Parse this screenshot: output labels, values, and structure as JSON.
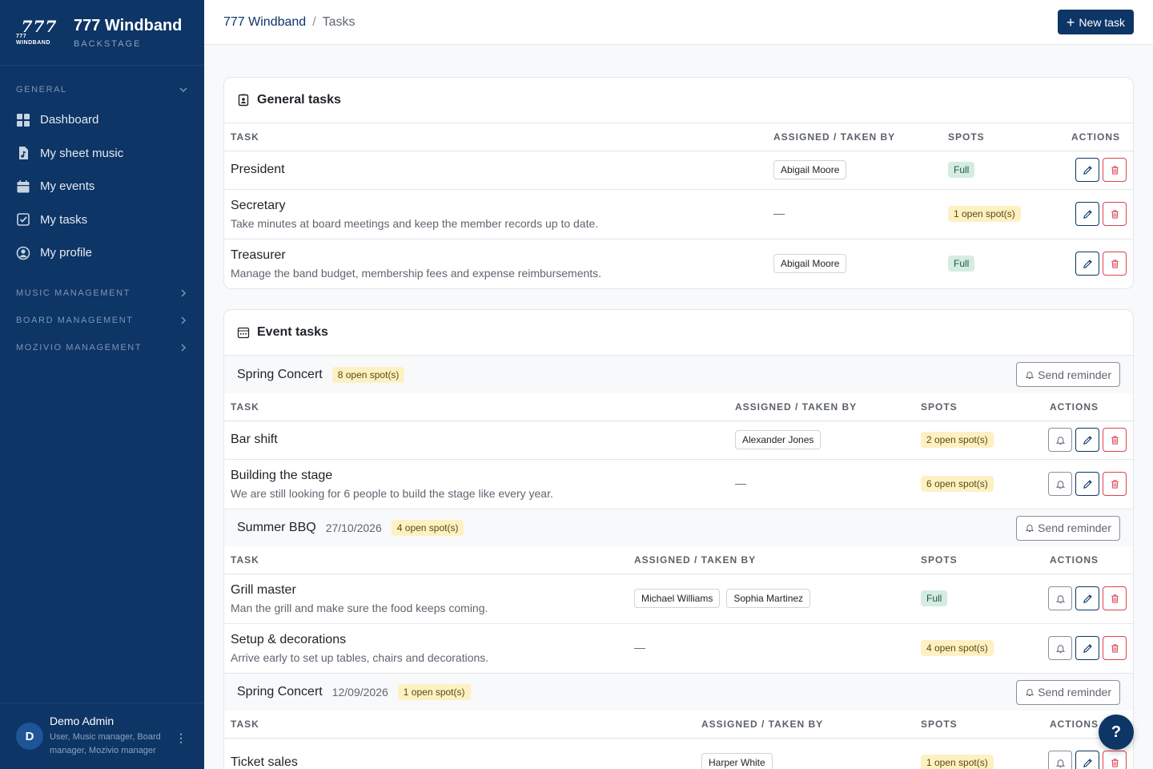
{
  "brand": {
    "logo_text": "777",
    "logo_sub": "777 WINDBAND",
    "name": "777 Windband",
    "sub": "BACKSTAGE"
  },
  "sidebar": {
    "general_label": "GENERAL",
    "items": [
      {
        "label": "Dashboard",
        "icon": "dashboard-icon"
      },
      {
        "label": "My sheet music",
        "icon": "sheet-music-icon"
      },
      {
        "label": "My events",
        "icon": "calendar-icon"
      },
      {
        "label": "My tasks",
        "icon": "checkbox-icon"
      },
      {
        "label": "My profile",
        "icon": "user-circle-icon"
      }
    ],
    "sections": [
      {
        "label": "MUSIC MANAGEMENT"
      },
      {
        "label": "BOARD MANAGEMENT"
      },
      {
        "label": "MOZIVIO MANAGEMENT"
      }
    ],
    "user": {
      "initial": "D",
      "name": "Demo Admin",
      "roles": "User, Music manager, Board manager, Mozivio manager"
    }
  },
  "breadcrumb": {
    "root": "777 Windband",
    "sep": "/",
    "current": "Tasks"
  },
  "new_task_label": "New task",
  "general": {
    "title": "General tasks",
    "columns": {
      "task": "TASK",
      "assigned": "ASSIGNED / TAKEN BY",
      "spots": "SPOTS",
      "actions": "ACTIONS"
    },
    "rows": [
      {
        "title": "President",
        "desc": "",
        "assigned": [
          "Abigail Moore"
        ],
        "spots": "Full",
        "full": true
      },
      {
        "title": "Secretary",
        "desc": "Take minutes at board meetings and keep the member records up to date.",
        "assigned": [],
        "spots": "1 open spot(s)",
        "full": false
      },
      {
        "title": "Treasurer",
        "desc": "Manage the band budget, membership fees and expense reimbursements.",
        "assigned": [
          "Abigail Moore"
        ],
        "spots": "Full",
        "full": true
      }
    ]
  },
  "events": {
    "title": "Event tasks",
    "reminder_label": "Send reminder",
    "dash": "—",
    "groups": [
      {
        "name": "Spring Concert",
        "date": "",
        "badge": "8 open spot(s)",
        "columns": {
          "task": "TASK",
          "assigned": "ASSIGNED / TAKEN BY",
          "spots": "SPOTS",
          "actions": "ACTIONS"
        },
        "rows": [
          {
            "title": "Bar shift",
            "desc": "",
            "assigned": [
              "Alexander Jones"
            ],
            "spots": "2 open spot(s)",
            "full": false
          },
          {
            "title": "Building the stage",
            "desc": "We are still looking for 6 people to build the stage like every year.",
            "assigned": [],
            "spots": "6 open spot(s)",
            "full": false
          }
        ]
      },
      {
        "name": "Summer BBQ",
        "date": "27/10/2026",
        "badge": "4 open spot(s)",
        "columns": {
          "task": "TASK",
          "assigned": "ASSIGNED / TAKEN BY",
          "spots": "SPOTS",
          "actions": "ACTIONS"
        },
        "rows": [
          {
            "title": "Grill master",
            "desc": "Man the grill and make sure the food keeps coming.",
            "assigned": [
              "Michael Williams",
              "Sophia Martinez"
            ],
            "spots": "Full",
            "full": true
          },
          {
            "title": "Setup & decorations",
            "desc": "Arrive early to set up tables, chairs and decorations.",
            "assigned": [],
            "spots": "4 open spot(s)",
            "full": false
          }
        ]
      },
      {
        "name": "Spring Concert",
        "date": "12/09/2026",
        "badge": "1 open spot(s)",
        "columns": {
          "task": "TASK",
          "assigned": "ASSIGNED / TAKEN BY",
          "spots": "SPOTS",
          "actions": "ACTIONS"
        },
        "rows": [
          {
            "title": "Ticket sales",
            "desc": "",
            "assigned": [
              "Harper White"
            ],
            "spots": "1 open spot(s)",
            "full": false
          }
        ]
      }
    ]
  },
  "help_label": "?"
}
